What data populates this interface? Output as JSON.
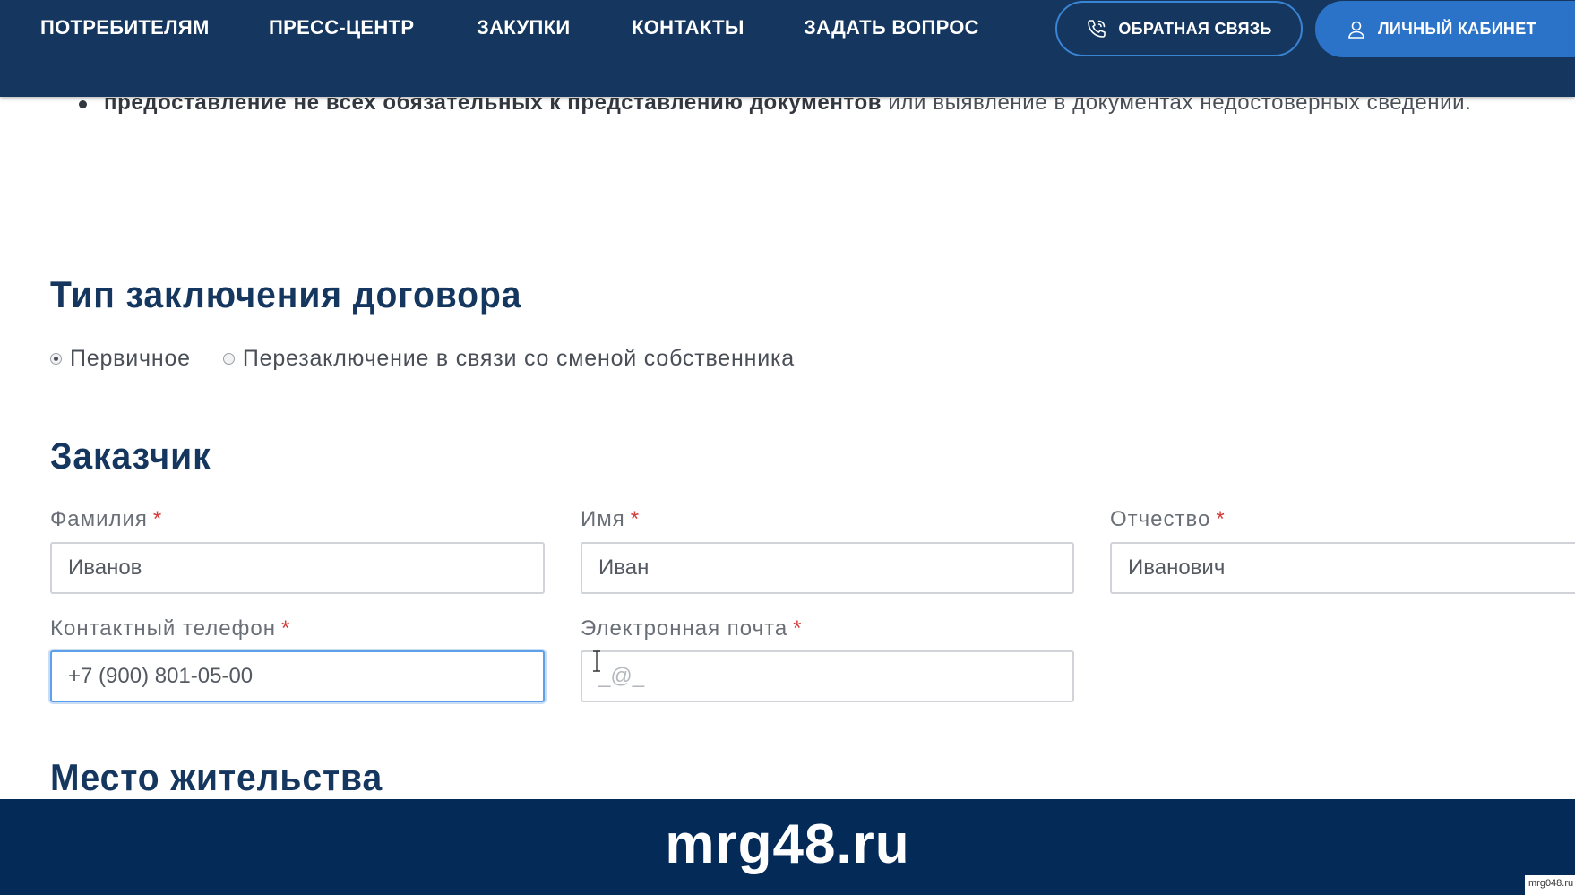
{
  "nav": {
    "links": [
      "ПОТРЕБИТЕЛЯМ",
      "ПРЕСС-ЦЕНТР",
      "ЗАКУПКИ",
      "КОНТАКТЫ",
      "ЗАДАТЬ ВОПРОС"
    ],
    "feedback_label": "ОБРАТНАЯ СВЯЗЬ",
    "feedback_icon": "phone-icon",
    "cabinet_label": "ЛИЧНЫЙ КАБИНЕТ",
    "cabinet_icon": "user-icon"
  },
  "bullet": {
    "bold": "предоставление не всех обязательных к представлению документов",
    "rest": " или выявление в документах недостоверных сведений."
  },
  "contract_type": {
    "title": "Тип заключения договора",
    "options": [
      "Первичное",
      "Перезаключение в связи со сменой собственника"
    ],
    "selected": "Первичное"
  },
  "customer": {
    "title": "Заказчик",
    "required_mark": "*",
    "last_name": {
      "label": "Фамилия",
      "value": "Иванов"
    },
    "first_name": {
      "label": "Имя",
      "value": "Иван"
    },
    "patronymic": {
      "label": "Отчество",
      "value": "Иванович"
    },
    "phone": {
      "label": "Контактный телефон",
      "value": "+7 (900) 801-05-00"
    },
    "email": {
      "label": "Электронная почта",
      "value": "",
      "placeholder": "_@_"
    }
  },
  "residence": {
    "title": "Место жительства"
  },
  "banner": {
    "text": "mrg48.ru",
    "corner_tag": "mrg048.ru"
  },
  "colors": {
    "nav_bg": "#15375f",
    "accent_blue": "#2b73c8",
    "heading": "#15375f",
    "required": "#d33b3b",
    "banner_bg": "#042a58"
  }
}
